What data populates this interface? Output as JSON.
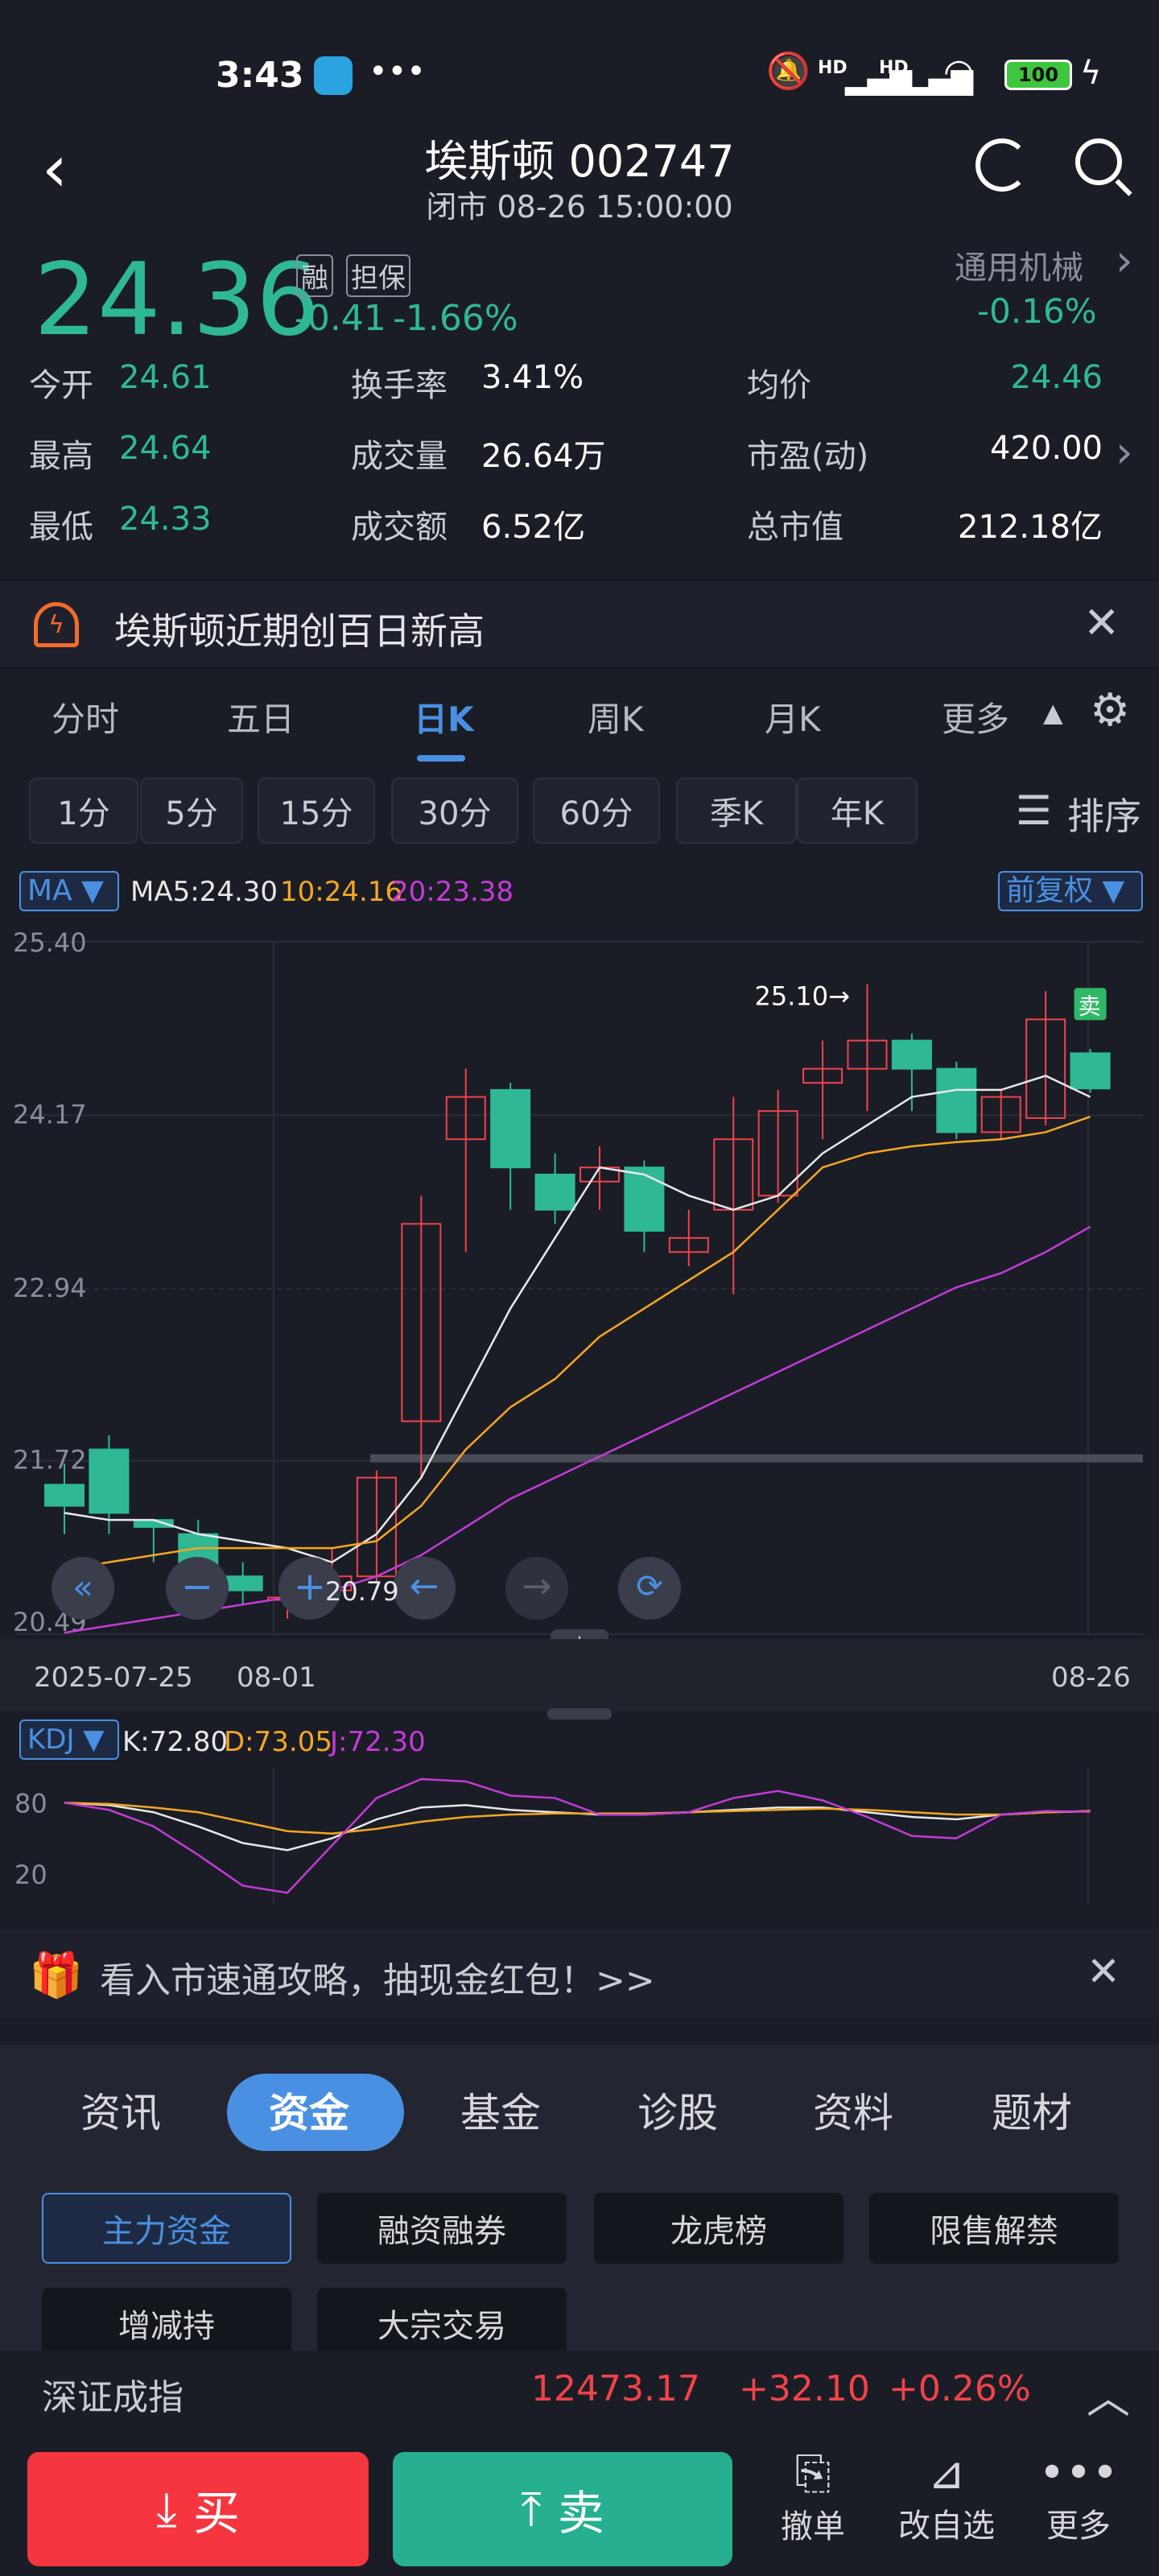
{
  "status_bar": {
    "time": "3:43",
    "battery": "100",
    "net1": "HD",
    "net2": "HD"
  },
  "header": {
    "title": "埃斯顿 002747",
    "subtitle": "闭市 08-26 15:00:00"
  },
  "quote": {
    "price": "24.36",
    "badge_margin": "融",
    "badge_collateral": "担保",
    "change": "-0.41",
    "change_pct": "-1.66%",
    "sector_name": "通用机械",
    "sector_change": "-0.16%",
    "stats": [
      {
        "label": "今开",
        "value": "24.61",
        "color": "green"
      },
      {
        "label": "换手率",
        "value": "3.41%",
        "color": "white"
      },
      {
        "label": "均价",
        "value": "24.46",
        "color": "green"
      },
      {
        "label": "最高",
        "value": "24.64",
        "color": "green"
      },
      {
        "label": "成交量",
        "value": "26.64万",
        "color": "white"
      },
      {
        "label": "市盈(动)",
        "value": "420.00",
        "color": "white"
      },
      {
        "label": "最低",
        "value": "24.33",
        "color": "green"
      },
      {
        "label": "成交额",
        "value": "6.52亿",
        "color": "white"
      },
      {
        "label": "总市值",
        "value": "212.18亿",
        "color": "white"
      }
    ]
  },
  "alert": {
    "text": "埃斯顿近期创百日新高"
  },
  "chart_tabs": [
    "分时",
    "五日",
    "日K",
    "周K",
    "月K",
    "更多"
  ],
  "chart_tab_active": "日K",
  "periods": [
    "1分",
    "5分",
    "15分",
    "30分",
    "60分",
    "季K",
    "年K"
  ],
  "sort_label": "排序",
  "ma": {
    "selector": "MA",
    "ma5": "MA5:24.30",
    "ma10": "10:24.16",
    "ma20": "20:23.38",
    "adjust": "前复权"
  },
  "kdj_legend": {
    "selector": "KDJ",
    "k": "K:72.80",
    "d": "D:73.05",
    "j": "J:72.30"
  },
  "colors": {
    "up": "#f2424a",
    "down": "#2fb894",
    "ma5": "#e8e8ea",
    "ma10": "#f5a623",
    "ma20": "#c43bd6",
    "accent": "#4a90e2",
    "bg": "#1a1d26"
  },
  "chart_data": [
    {
      "type": "candlestick",
      "title": "",
      "ylim": [
        20.49,
        25.4
      ],
      "y_ticks": [
        "25.40",
        "24.17",
        "22.94",
        "21.72",
        "20.49"
      ],
      "x_labels": [
        "2025-07-25",
        "08-01",
        "08-26"
      ],
      "annotations": {
        "high_label": "25.10→",
        "low_label": "20.79",
        "sell_marker": "卖"
      },
      "candles": [
        {
          "o": 21.55,
          "c": 21.4,
          "h": 21.7,
          "l": 21.2
        },
        {
          "o": 21.8,
          "c": 21.35,
          "h": 21.9,
          "l": 21.2
        },
        {
          "o": 21.3,
          "c": 21.25,
          "h": 21.3,
          "l": 21.0
        },
        {
          "o": 21.2,
          "c": 20.9,
          "h": 21.3,
          "l": 20.8
        },
        {
          "o": 20.9,
          "c": 20.8,
          "h": 21.0,
          "l": 20.7
        },
        {
          "o": 20.75,
          "c": 20.75,
          "h": 20.9,
          "l": 20.6
        },
        {
          "o": 20.8,
          "c": 20.9,
          "h": 21.1,
          "l": 20.79
        },
        {
          "o": 20.9,
          "c": 21.6,
          "h": 21.65,
          "l": 20.85
        },
        {
          "o": 22.0,
          "c": 23.4,
          "h": 23.6,
          "l": 21.6
        },
        {
          "o": 24.0,
          "c": 24.3,
          "h": 24.5,
          "l": 23.2
        },
        {
          "o": 24.35,
          "c": 23.8,
          "h": 24.4,
          "l": 23.5
        },
        {
          "o": 23.75,
          "c": 23.5,
          "h": 23.9,
          "l": 23.4
        },
        {
          "o": 23.7,
          "c": 23.8,
          "h": 23.95,
          "l": 23.5
        },
        {
          "o": 23.8,
          "c": 23.35,
          "h": 23.85,
          "l": 23.2
        },
        {
          "o": 23.2,
          "c": 23.3,
          "h": 23.5,
          "l": 23.1
        },
        {
          "o": 23.5,
          "c": 24.0,
          "h": 24.3,
          "l": 22.9
        },
        {
          "o": 23.6,
          "c": 24.2,
          "h": 24.35,
          "l": 23.55
        },
        {
          "o": 24.4,
          "c": 24.5,
          "h": 24.7,
          "l": 24.0
        },
        {
          "o": 24.5,
          "c": 24.7,
          "h": 25.1,
          "l": 24.2
        },
        {
          "o": 24.7,
          "c": 24.5,
          "h": 24.75,
          "l": 24.2
        },
        {
          "o": 24.5,
          "c": 24.05,
          "h": 24.55,
          "l": 24.0
        },
        {
          "o": 24.05,
          "c": 24.3,
          "h": 24.35,
          "l": 24.0
        },
        {
          "o": 24.15,
          "c": 24.85,
          "h": 25.05,
          "l": 24.1
        },
        {
          "o": 24.61,
          "c": 24.36,
          "h": 24.64,
          "l": 24.33
        }
      ],
      "ma5": [
        21.35,
        21.3,
        21.3,
        21.2,
        21.15,
        21.1,
        21.0,
        21.2,
        21.6,
        22.2,
        22.8,
        23.3,
        23.8,
        23.75,
        23.6,
        23.5,
        23.6,
        23.9,
        24.1,
        24.3,
        24.35,
        24.35,
        24.45,
        24.3
      ],
      "ma10": [
        20.95,
        21.0,
        21.05,
        21.1,
        21.1,
        21.1,
        21.1,
        21.15,
        21.4,
        21.8,
        22.1,
        22.3,
        22.6,
        22.8,
        23.0,
        23.2,
        23.5,
        23.8,
        23.9,
        23.95,
        23.98,
        24.0,
        24.05,
        24.16
      ],
      "ma20": [
        20.5,
        20.55,
        20.6,
        20.65,
        20.7,
        20.75,
        20.8,
        20.9,
        21.05,
        21.25,
        21.45,
        21.6,
        21.75,
        21.9,
        22.05,
        22.2,
        22.35,
        22.5,
        22.65,
        22.8,
        22.95,
        23.05,
        23.2,
        23.38
      ]
    },
    {
      "type": "line",
      "title": "",
      "ylim": [
        0,
        100
      ],
      "y_ticks": [
        "80",
        "20"
      ],
      "series": [
        {
          "name": "K",
          "values": [
            80,
            78,
            72,
            60,
            46,
            40,
            50,
            66,
            76,
            78,
            74,
            72,
            70,
            70,
            72,
            74,
            76,
            76,
            72,
            68,
            66,
            70,
            72,
            72.8
          ]
        },
        {
          "name": "D",
          "values": [
            80,
            79,
            76,
            72,
            64,
            56,
            54,
            58,
            64,
            68,
            70,
            71,
            71,
            71,
            72,
            73,
            74,
            75,
            74,
            72,
            70,
            70,
            72,
            73.05
          ]
        },
        {
          "name": "J",
          "values": [
            80,
            74,
            60,
            36,
            10,
            4,
            44,
            84,
            100,
            98,
            86,
            84,
            70,
            70,
            72,
            84,
            90,
            82,
            68,
            52,
            50,
            70,
            73,
            72.3
          ]
        }
      ]
    }
  ],
  "promo": {
    "text": "看入市速通攻略，抽现金红包！>>"
  },
  "bottom_tabs": [
    "资讯",
    "资金",
    "基金",
    "诊股",
    "资料",
    "题材"
  ],
  "bottom_tab_active": "资金",
  "fund_buttons": [
    "主力资金",
    "融资融券",
    "龙虎榜",
    "限售解禁",
    "增减持",
    "大宗交易"
  ],
  "index_ticker": {
    "name": "深证成指",
    "value": "12473.17",
    "change": "+32.10",
    "pct": "+0.26%"
  },
  "trade": {
    "buy": "买",
    "sell": "卖",
    "tools": [
      "撤单",
      "改自选",
      "更多"
    ]
  }
}
